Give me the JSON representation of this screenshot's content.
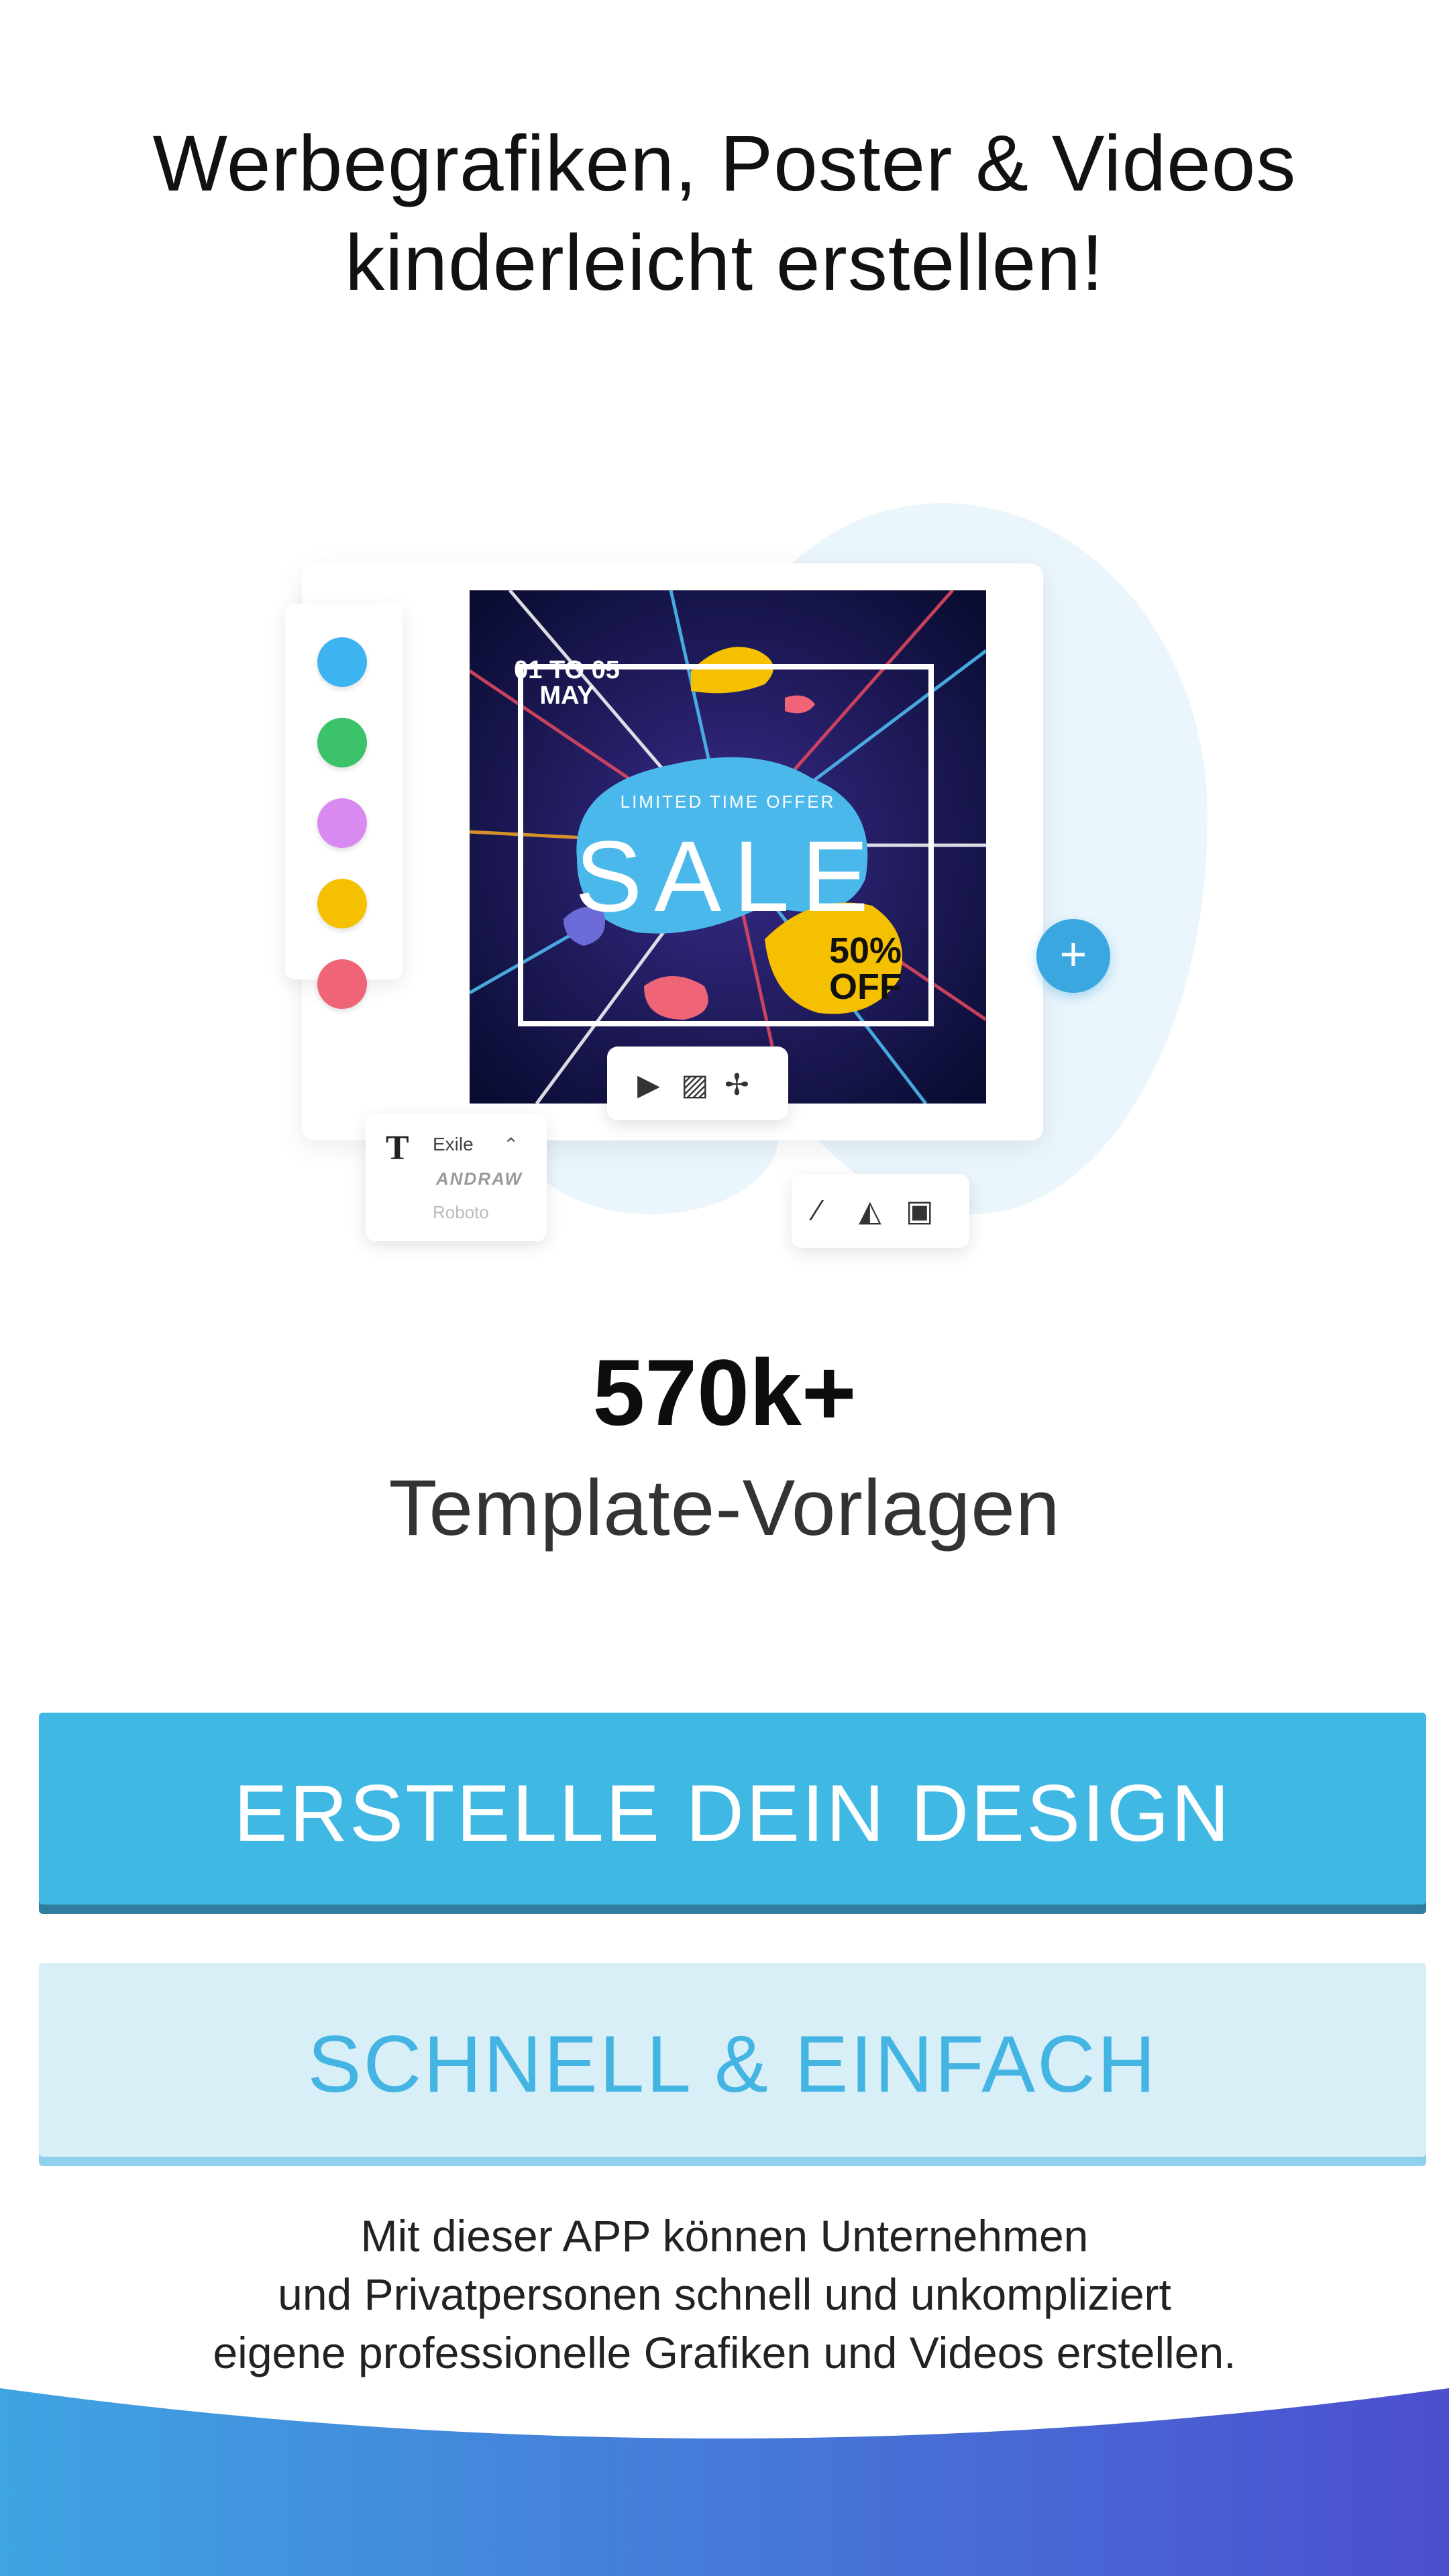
{
  "headline": {
    "line1": "Werbegrafiken, Poster & Videos",
    "line2": "kinderleicht erstellen!"
  },
  "illustration": {
    "palette_colors": [
      "#3db4f0",
      "#3cc36a",
      "#d98af0",
      "#f5c000",
      "#f06478"
    ],
    "poster": {
      "date_line1": "01 TO 05",
      "date_line2": "MAY",
      "limited": "LIMITED TIME OFFER",
      "sale": "SALE",
      "off_line1": "50%",
      "off_line2": "OFF"
    },
    "font_panel": {
      "title": "Exile",
      "font2": "ANDRAW",
      "font3": "Roboto"
    },
    "icons": {
      "plus": "plus-icon",
      "play": "play-icon",
      "pattern": "pattern-icon",
      "effects": "effects-icon",
      "magic": "magic-wand-icon",
      "shapes": "shapes-icon",
      "image": "image-icon",
      "text": "text-icon"
    }
  },
  "stat": {
    "number": "570k+",
    "label": "Template-Vorlagen"
  },
  "buttons": {
    "primary": "ERSTELLE DEIN DESIGN",
    "secondary": "SCHNELL & EINFACH"
  },
  "description": {
    "line1": "Mit dieser APP können Unternehmen",
    "line2": "und Privatpersonen schnell und unkompliziert",
    "line3": "eigene professionelle Grafiken und Videos erstellen."
  },
  "colors": {
    "accent": "#40b8e4",
    "accent_light": "#d8eff8",
    "footer_gradient_start": "#3fa4e2",
    "footer_gradient_end": "#4c4fcf"
  }
}
